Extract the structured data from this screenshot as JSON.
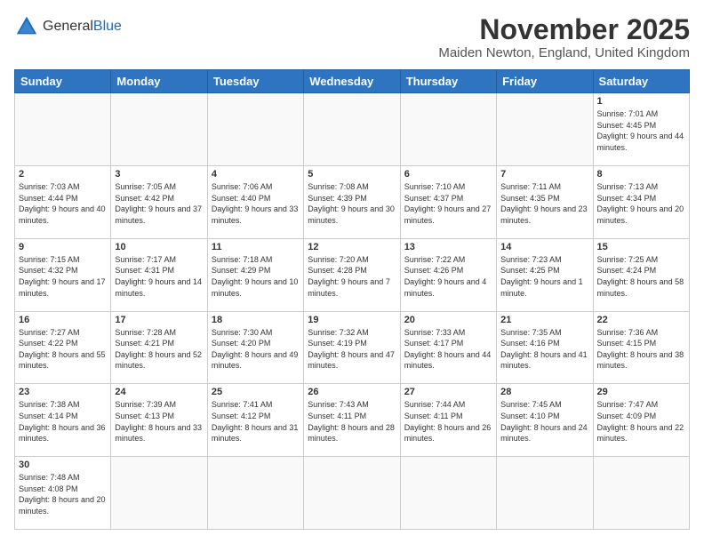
{
  "logo": {
    "general": "General",
    "blue": "Blue"
  },
  "header": {
    "month": "November 2025",
    "location": "Maiden Newton, England, United Kingdom"
  },
  "weekdays": [
    "Sunday",
    "Monday",
    "Tuesday",
    "Wednesday",
    "Thursday",
    "Friday",
    "Saturday"
  ],
  "weeks": [
    [
      {
        "day": "",
        "info": ""
      },
      {
        "day": "",
        "info": ""
      },
      {
        "day": "",
        "info": ""
      },
      {
        "day": "",
        "info": ""
      },
      {
        "day": "",
        "info": ""
      },
      {
        "day": "",
        "info": ""
      },
      {
        "day": "1",
        "info": "Sunrise: 7:01 AM\nSunset: 4:45 PM\nDaylight: 9 hours and 44 minutes."
      }
    ],
    [
      {
        "day": "2",
        "info": "Sunrise: 7:03 AM\nSunset: 4:44 PM\nDaylight: 9 hours and 40 minutes."
      },
      {
        "day": "3",
        "info": "Sunrise: 7:05 AM\nSunset: 4:42 PM\nDaylight: 9 hours and 37 minutes."
      },
      {
        "day": "4",
        "info": "Sunrise: 7:06 AM\nSunset: 4:40 PM\nDaylight: 9 hours and 33 minutes."
      },
      {
        "day": "5",
        "info": "Sunrise: 7:08 AM\nSunset: 4:39 PM\nDaylight: 9 hours and 30 minutes."
      },
      {
        "day": "6",
        "info": "Sunrise: 7:10 AM\nSunset: 4:37 PM\nDaylight: 9 hours and 27 minutes."
      },
      {
        "day": "7",
        "info": "Sunrise: 7:11 AM\nSunset: 4:35 PM\nDaylight: 9 hours and 23 minutes."
      },
      {
        "day": "8",
        "info": "Sunrise: 7:13 AM\nSunset: 4:34 PM\nDaylight: 9 hours and 20 minutes."
      }
    ],
    [
      {
        "day": "9",
        "info": "Sunrise: 7:15 AM\nSunset: 4:32 PM\nDaylight: 9 hours and 17 minutes."
      },
      {
        "day": "10",
        "info": "Sunrise: 7:17 AM\nSunset: 4:31 PM\nDaylight: 9 hours and 14 minutes."
      },
      {
        "day": "11",
        "info": "Sunrise: 7:18 AM\nSunset: 4:29 PM\nDaylight: 9 hours and 10 minutes."
      },
      {
        "day": "12",
        "info": "Sunrise: 7:20 AM\nSunset: 4:28 PM\nDaylight: 9 hours and 7 minutes."
      },
      {
        "day": "13",
        "info": "Sunrise: 7:22 AM\nSunset: 4:26 PM\nDaylight: 9 hours and 4 minutes."
      },
      {
        "day": "14",
        "info": "Sunrise: 7:23 AM\nSunset: 4:25 PM\nDaylight: 9 hours and 1 minute."
      },
      {
        "day": "15",
        "info": "Sunrise: 7:25 AM\nSunset: 4:24 PM\nDaylight: 8 hours and 58 minutes."
      }
    ],
    [
      {
        "day": "16",
        "info": "Sunrise: 7:27 AM\nSunset: 4:22 PM\nDaylight: 8 hours and 55 minutes."
      },
      {
        "day": "17",
        "info": "Sunrise: 7:28 AM\nSunset: 4:21 PM\nDaylight: 8 hours and 52 minutes."
      },
      {
        "day": "18",
        "info": "Sunrise: 7:30 AM\nSunset: 4:20 PM\nDaylight: 8 hours and 49 minutes."
      },
      {
        "day": "19",
        "info": "Sunrise: 7:32 AM\nSunset: 4:19 PM\nDaylight: 8 hours and 47 minutes."
      },
      {
        "day": "20",
        "info": "Sunrise: 7:33 AM\nSunset: 4:17 PM\nDaylight: 8 hours and 44 minutes."
      },
      {
        "day": "21",
        "info": "Sunrise: 7:35 AM\nSunset: 4:16 PM\nDaylight: 8 hours and 41 minutes."
      },
      {
        "day": "22",
        "info": "Sunrise: 7:36 AM\nSunset: 4:15 PM\nDaylight: 8 hours and 38 minutes."
      }
    ],
    [
      {
        "day": "23",
        "info": "Sunrise: 7:38 AM\nSunset: 4:14 PM\nDaylight: 8 hours and 36 minutes."
      },
      {
        "day": "24",
        "info": "Sunrise: 7:39 AM\nSunset: 4:13 PM\nDaylight: 8 hours and 33 minutes."
      },
      {
        "day": "25",
        "info": "Sunrise: 7:41 AM\nSunset: 4:12 PM\nDaylight: 8 hours and 31 minutes."
      },
      {
        "day": "26",
        "info": "Sunrise: 7:43 AM\nSunset: 4:11 PM\nDaylight: 8 hours and 28 minutes."
      },
      {
        "day": "27",
        "info": "Sunrise: 7:44 AM\nSunset: 4:11 PM\nDaylight: 8 hours and 26 minutes."
      },
      {
        "day": "28",
        "info": "Sunrise: 7:45 AM\nSunset: 4:10 PM\nDaylight: 8 hours and 24 minutes."
      },
      {
        "day": "29",
        "info": "Sunrise: 7:47 AM\nSunset: 4:09 PM\nDaylight: 8 hours and 22 minutes."
      }
    ],
    [
      {
        "day": "30",
        "info": "Sunrise: 7:48 AM\nSunset: 4:08 PM\nDaylight: 8 hours and 20 minutes."
      },
      {
        "day": "",
        "info": ""
      },
      {
        "day": "",
        "info": ""
      },
      {
        "day": "",
        "info": ""
      },
      {
        "day": "",
        "info": ""
      },
      {
        "day": "",
        "info": ""
      },
      {
        "day": "",
        "info": ""
      }
    ]
  ]
}
